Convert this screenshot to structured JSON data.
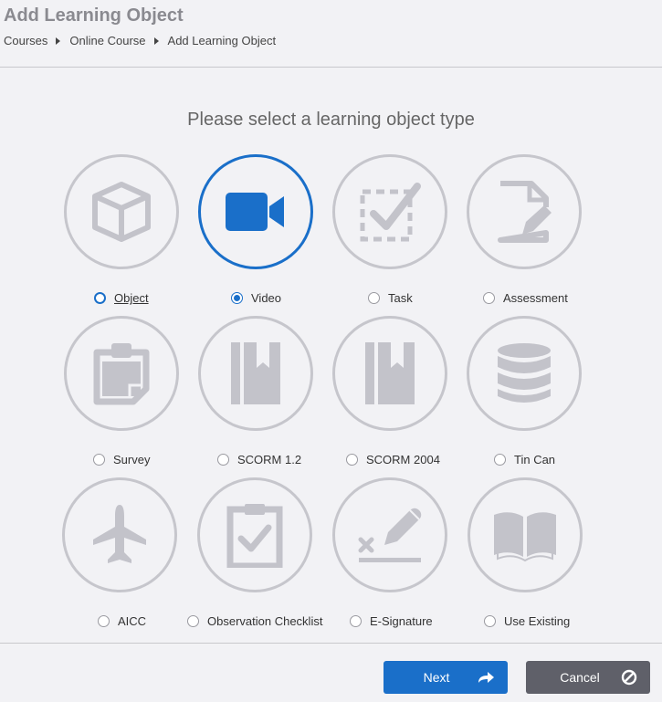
{
  "header": {
    "title": "Add Learning Object",
    "breadcrumb": [
      "Courses",
      "Online Course",
      "Add Learning Object"
    ]
  },
  "content": {
    "prompt": "Please select a learning object type",
    "selected_type": "Video",
    "types": [
      {
        "label": "Object",
        "icon": "cube-icon"
      },
      {
        "label": "Video",
        "icon": "video-camera-icon"
      },
      {
        "label": "Task",
        "icon": "task-checkbox-icon"
      },
      {
        "label": "Assessment",
        "icon": "document-edit-icon"
      },
      {
        "label": "Survey",
        "icon": "clipboard-icon"
      },
      {
        "label": "SCORM 1.2",
        "icon": "book-icon"
      },
      {
        "label": "SCORM 2004",
        "icon": "book-icon"
      },
      {
        "label": "Tin Can",
        "icon": "database-icon"
      },
      {
        "label": "AICC",
        "icon": "airplane-icon"
      },
      {
        "label": "Observation Checklist",
        "icon": "checklist-clipboard-icon"
      },
      {
        "label": "E-Signature",
        "icon": "signature-pen-icon"
      },
      {
        "label": "Use Existing",
        "icon": "open-book-icon"
      }
    ]
  },
  "footer": {
    "next_label": "Next",
    "cancel_label": "Cancel"
  },
  "colors": {
    "accent": "#1a6fc9",
    "icon_gray": "#c3c3ca",
    "cancel_bg": "#5f6069"
  }
}
